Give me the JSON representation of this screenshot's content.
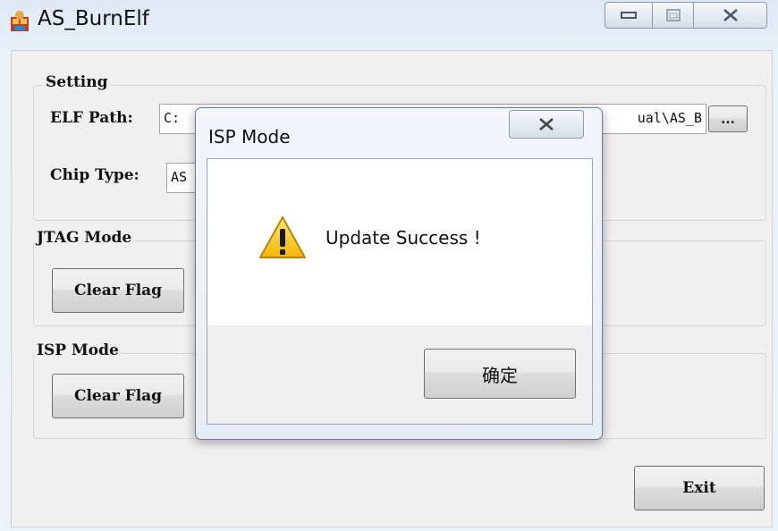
{
  "window": {
    "title": "AS_BurnElf",
    "app_icon": "app-icon",
    "controls": {
      "minimize_icon": "minimize-icon",
      "maximize_icon": "maximize-icon",
      "close_icon": "close-icon"
    }
  },
  "setting": {
    "group_label": "Setting",
    "elf_path_label": "ELF Path:",
    "elf_path_value_visible_start": "C:",
    "elf_path_value_visible_end": "ual\\AS_B",
    "browse_label": "...",
    "chip_type_label": "Chip Type:",
    "chip_type_value_visible": "AS"
  },
  "jtag": {
    "group_label": "JTAG Mode",
    "clear_flag_label": "Clear Flag"
  },
  "isp": {
    "group_label": "ISP Mode",
    "clear_flag_label": "Clear Flag"
  },
  "exit_label": "Exit",
  "dialog": {
    "title": "ISP Mode",
    "message": "Update Success !",
    "ok_label": "确定",
    "icon": "warning-icon",
    "close_icon": "close-icon"
  }
}
